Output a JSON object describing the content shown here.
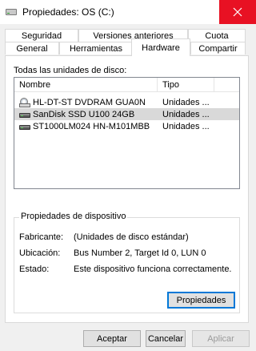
{
  "window": {
    "title": "Propiedades: OS (C:)"
  },
  "tabs": {
    "row_back": [
      "Seguridad",
      "Versiones anteriores",
      "Cuota"
    ],
    "row_front": [
      "General",
      "Herramientas",
      "Hardware",
      "Compartir"
    ],
    "active": "Hardware"
  },
  "hardware": {
    "all_disks_label": "Todas las unidades de disco:",
    "columns": {
      "name": "Nombre",
      "type": "Tipo"
    },
    "devices": [
      {
        "name": "HL-DT-ST DVDRAM GUA0N",
        "type": "Unidades ...",
        "icon": "dvd-drive-icon"
      },
      {
        "name": "SanDisk SSD U100 24GB",
        "type": "Unidades ...",
        "icon": "disk-drive-icon"
      },
      {
        "name": "ST1000LM024 HN-M101MBB",
        "type": "Unidades ...",
        "icon": "disk-drive-icon"
      }
    ],
    "selected_index": 1,
    "properties_group": {
      "title": "Propiedades de dispositivo",
      "manufacturer_label": "Fabricante:",
      "manufacturer_value": "(Unidades de disco estándar)",
      "location_label": "Ubicación:",
      "location_value": "Bus Number 2, Target Id 0, LUN 0",
      "status_label": "Estado:",
      "status_value": "Este dispositivo funciona correctamente."
    },
    "properties_button": "Propiedades"
  },
  "footer": {
    "ok": "Aceptar",
    "cancel": "Cancelar",
    "apply": "Aplicar"
  },
  "colors": {
    "close_button": "#e81123",
    "selection": "#d9d9d9",
    "default_button_border": "#0078d7"
  }
}
